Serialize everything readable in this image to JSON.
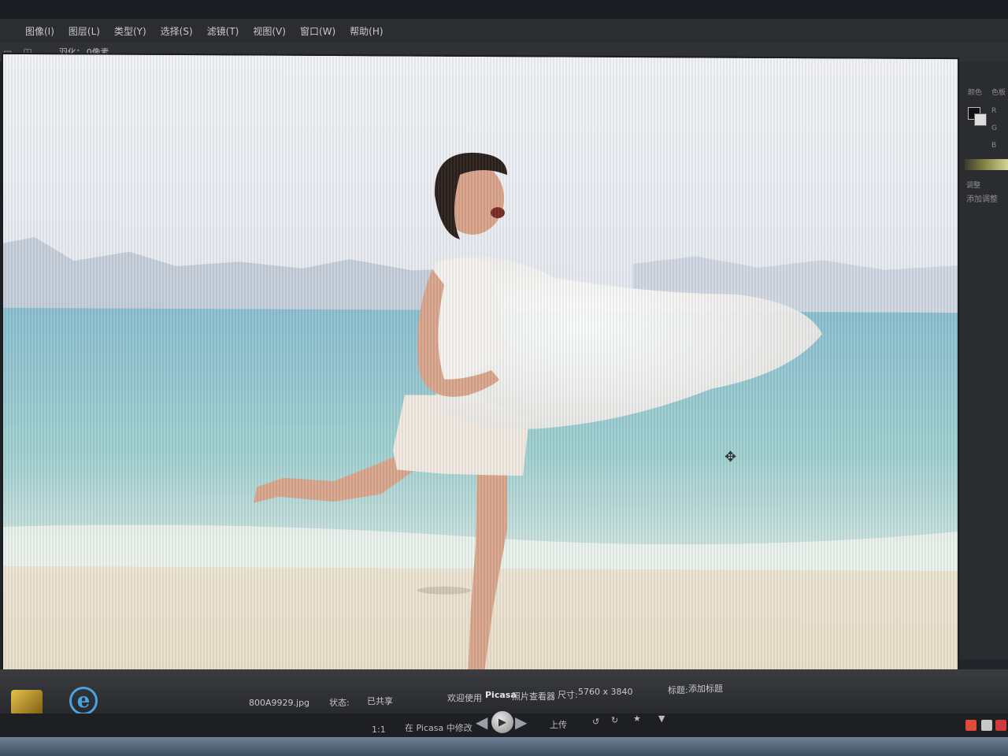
{
  "menu": {
    "items": [
      "图像(I)",
      "图层(L)",
      "类型(Y)",
      "选择(S)",
      "滤镜(T)",
      "视图(V)",
      "窗口(W)",
      "帮助(H)"
    ]
  },
  "options": {
    "feather_label": "羽化：",
    "feather_value": "0像素"
  },
  "right_panel": {
    "color_tab": "颜色",
    "swatches_tab": "色板",
    "adjust_tab": "调整",
    "add_adjustment": "添加调整",
    "channel_r": "R",
    "channel_g": "G",
    "channel_b": "B"
  },
  "picasa": {
    "filename": "800A9929.jpg",
    "status_label": "状态:",
    "status_value": "已共享",
    "welcome_prefix": "欢迎使用",
    "app_name": "Picasa",
    "welcome_suffix": "照片查看器",
    "size_label": "尺寸:",
    "size_value": "5760 x 3840",
    "caption_label": "标题:",
    "caption_value": "添加标题",
    "zoom_ratio": "1:1",
    "open_in_picasa": "在 Picasa 中修改",
    "upload_label": "上传"
  },
  "colors": {
    "menubar_bg": "#2b2d31",
    "panel_bg": "#2a2c30",
    "sky": "#e9edf2",
    "sea": "#8cc6cf",
    "sand": "#ece4d4"
  },
  "icons": [
    "move-cursor-icon",
    "play-icon",
    "prev-arrow-icon",
    "next-arrow-icon",
    "rotate-left-icon",
    "rotate-right-icon",
    "star-icon",
    "ie-browser-icon"
  ]
}
